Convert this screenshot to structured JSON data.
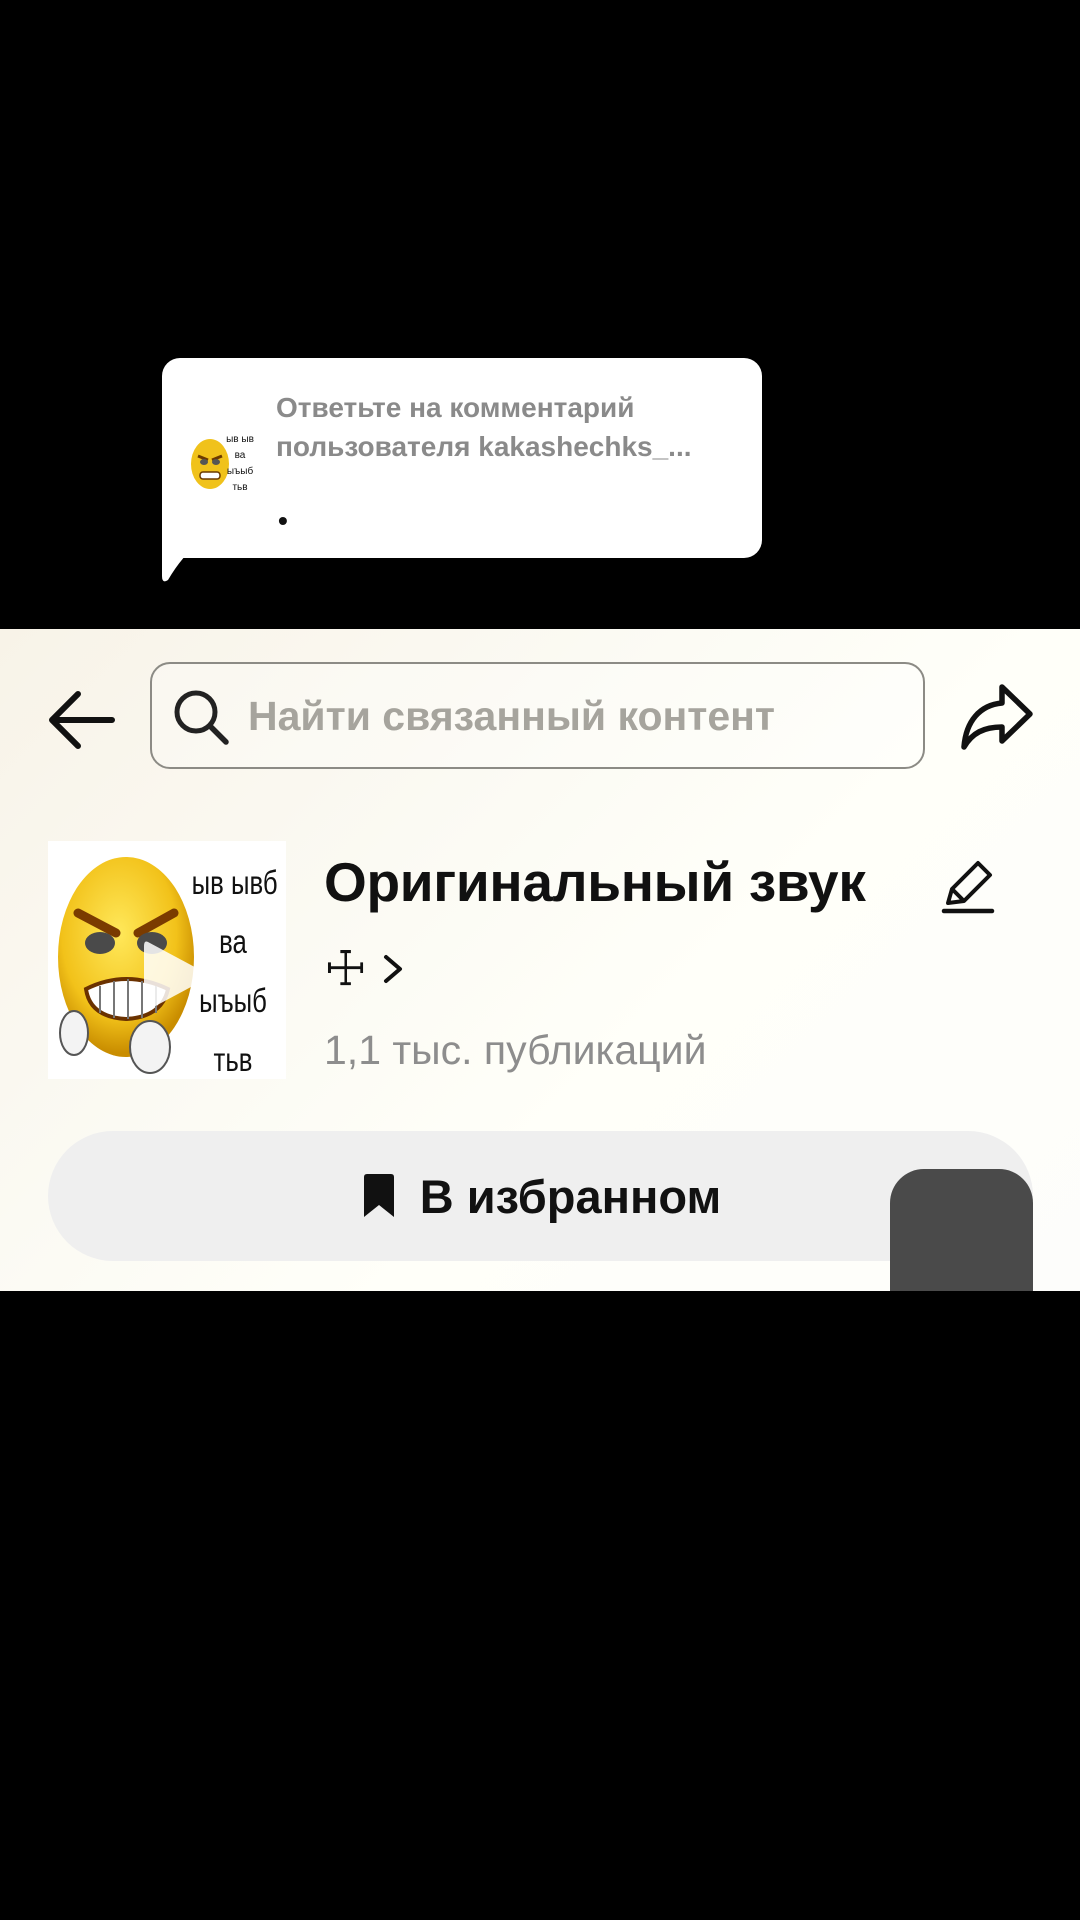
{
  "comment_reply": {
    "line1": "Ответьте на комментарий",
    "line2": "пользователя kakashechks_...",
    "body": "•"
  },
  "header": {
    "back_icon": "arrow-left-icon",
    "search": {
      "placeholder": "Найти связанный контент",
      "value": ""
    },
    "share_icon": "share-arrow-icon"
  },
  "sound": {
    "cover_caption": [
      "ыв ывб",
      "ва",
      "ыъыб",
      "тьв"
    ],
    "title": "Оригинальный звук",
    "author": "☩",
    "posts": "1,1 тыс. публикаций"
  },
  "favorite_button": {
    "label": "В избранном",
    "icon": "bookmark-filled-icon"
  },
  "colors": {
    "panel_bg": "#fbf8ee",
    "button_bg": "#efefef",
    "muted_text": "#8d8d8d",
    "floating_tab": "#4a4a4a"
  }
}
